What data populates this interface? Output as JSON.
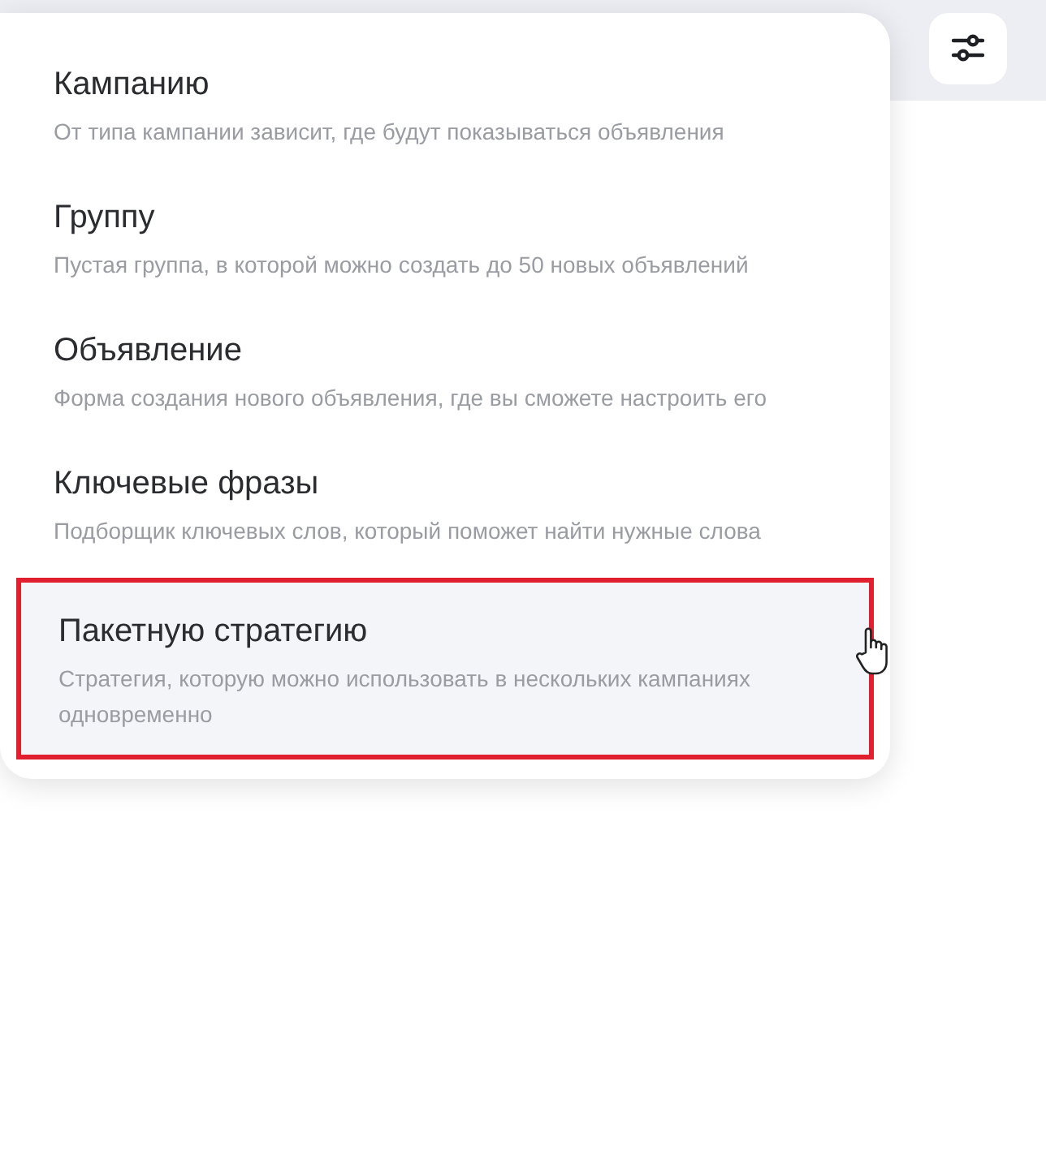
{
  "menu": {
    "items": [
      {
        "title": "Кампанию",
        "description": "От типа кампании зависит, где будут показываться объявления",
        "selected": false
      },
      {
        "title": "Группу",
        "description": "Пустая группа, в которой можно создать до 50 новых объявлений",
        "selected": false
      },
      {
        "title": "Объявление",
        "description": "Форма создания нового объявления, где вы сможете настроить его",
        "selected": false
      },
      {
        "title": "Ключевые фразы",
        "description": "Подборщик ключевых слов, который поможет найти нужные слова",
        "selected": false
      },
      {
        "title": "Пакетную стратегию",
        "description": "Стратегия, которую можно использовать в нескольких кампаниях одновременно",
        "selected": true
      }
    ]
  }
}
